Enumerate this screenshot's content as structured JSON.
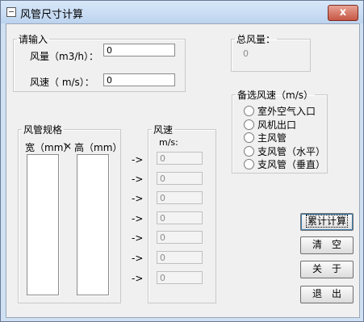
{
  "window": {
    "title": "风管尺寸计算",
    "close_glyph": "x"
  },
  "input_group": {
    "legend": "请输入",
    "airflow_label": "风量（m3/h）：",
    "airflow_value": "0",
    "velocity_label": "风速（ m/s）：",
    "velocity_value": "0"
  },
  "total_group": {
    "legend": "总风量：",
    "value": "0"
  },
  "speed_options": {
    "legend": "备选风速（m/s）",
    "options": [
      "室外空气入口",
      "风机出口",
      "主风管",
      "支风管（水平）",
      "支风管（垂直）"
    ]
  },
  "duct_spec": {
    "legend": "风管规格",
    "width_label": "宽（mm）",
    "times": "×",
    "height_label": "高（mm）"
  },
  "speed_group": {
    "legend": "风速",
    "unit": "m/s:",
    "arrow": "->",
    "values": [
      "0",
      "0",
      "0",
      "0",
      "0",
      "0",
      "0"
    ]
  },
  "buttons": {
    "accumulate": "累计计算",
    "clear": "清　空",
    "about": "关　于",
    "exit": "退　出"
  }
}
